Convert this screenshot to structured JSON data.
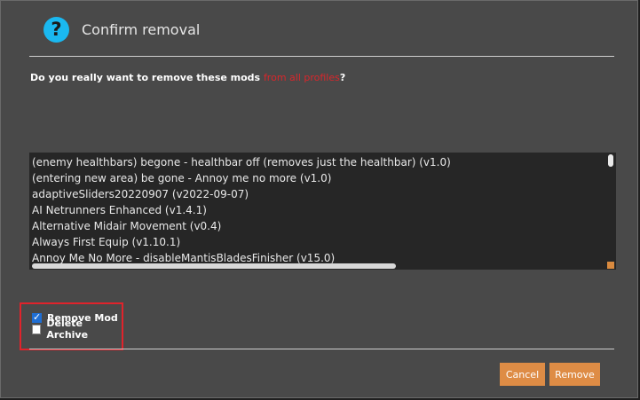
{
  "dialog": {
    "title": "Confirm removal",
    "question_prefix": "Do you really want to remove these mods ",
    "question_highlight": "from all profiles",
    "question_suffix": "?"
  },
  "mods": [
    "(enemy healthbars) begone - healthbar off (removes just the healthbar) (v1.0)",
    "(entering new area) be gone - Annoy me no more (v1.0)",
    "adaptiveSliders20220907 (v2022-09-07)",
    "AI Netrunners Enhanced (v1.4.1)",
    "Alternative Midair Movement (v0.4)",
    "Always First Equip (v1.10.1)",
    "Annoy Me No More - disableMantisBladesFinisher (v15.0)"
  ],
  "options": {
    "remove_mod": {
      "label": "Remove Mod",
      "checked": true
    },
    "delete_archive": {
      "label": "Delete Archive",
      "checked": false
    }
  },
  "buttons": {
    "cancel": "Cancel",
    "remove": "Remove"
  },
  "colors": {
    "accent": "#de8c45",
    "highlight": "#d9262b",
    "info_icon": "#1ab8f0"
  },
  "icons": {
    "header": "question-icon"
  }
}
